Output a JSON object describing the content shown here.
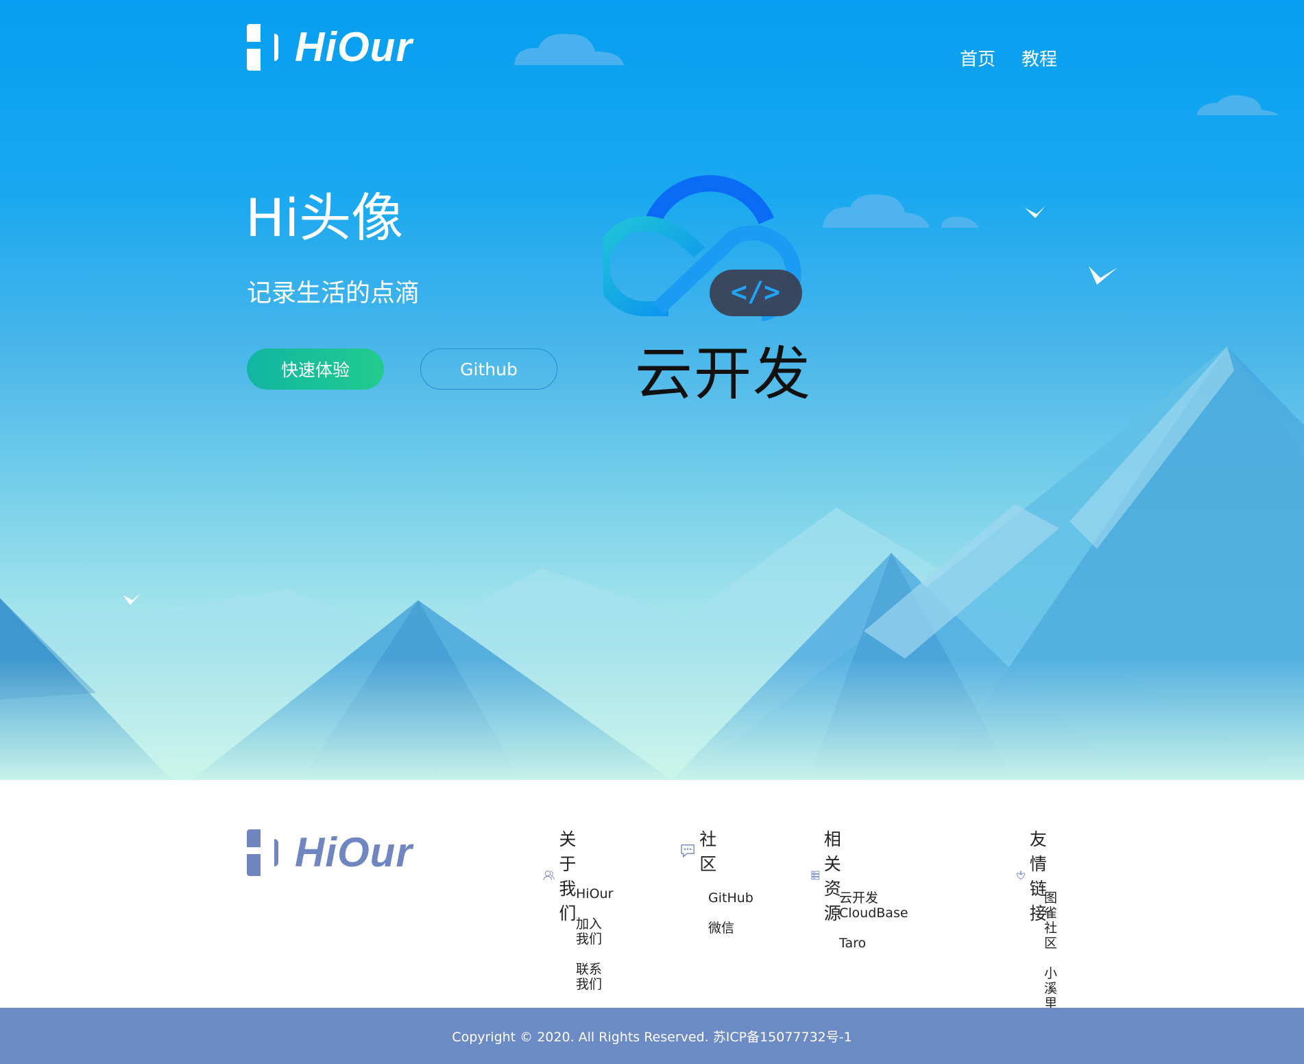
{
  "header": {
    "logo_text": "HiOur",
    "nav": [
      {
        "label": "首页"
      },
      {
        "label": "教程"
      }
    ]
  },
  "hero": {
    "title": "Hi头像",
    "subtitle": "记录生活的点滴",
    "primary_button": "快速体验",
    "secondary_button": "Github",
    "partner_logo_text": "云开发",
    "partner_logo_code_glyph": "</>"
  },
  "footer": {
    "logo_text": "HiOur",
    "columns": [
      {
        "heading": "关于我们",
        "icon": "users-icon",
        "links": [
          "HiOur",
          "加入我们",
          "联系我们"
        ]
      },
      {
        "heading": "社区",
        "icon": "chat-bubble-icon",
        "links": [
          "GitHub",
          "微信"
        ]
      },
      {
        "heading": "相关资源",
        "icon": "server-icon",
        "links": [
          "云开发CloudBase",
          "Taro"
        ]
      },
      {
        "heading": "友情链接",
        "icon": "flower-icon",
        "links": [
          "图雀社区",
          "小溪里博客"
        ]
      }
    ],
    "copyright": "Copyright © 2020. All Rights Reserved. 苏ICP备15077732号-1"
  },
  "colors": {
    "hero_top": "#069ef0",
    "hero_bottom": "#d0f7ec",
    "primary_button": "#16bf98",
    "footer_logo": "#6f86c0",
    "copyright_bar": "#6c8ac4"
  }
}
